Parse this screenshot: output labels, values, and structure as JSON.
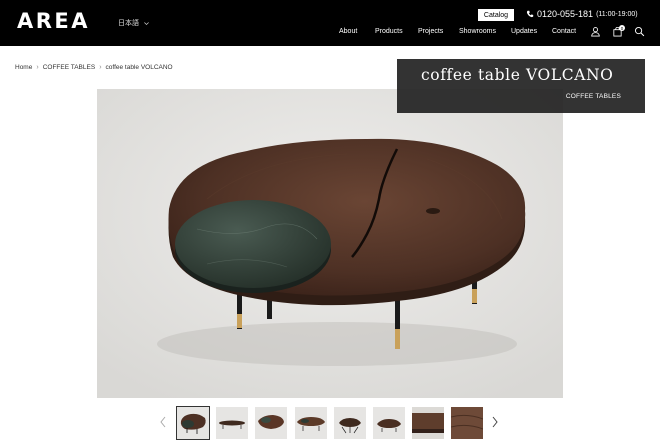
{
  "header": {
    "logo": "AREA",
    "language": "日本語",
    "catalog_label": "Catalog",
    "phone": "0120-055-181",
    "hours": "(11:00-19:00)",
    "nav": [
      "About",
      "Products",
      "Projects",
      "Showrooms",
      "Updates",
      "Contact"
    ],
    "cart_count": "0"
  },
  "breadcrumb": [
    "Home",
    "COFFEE TABLES",
    "coffee table VOLCANO"
  ],
  "product": {
    "title": "coffee table VOLCANO",
    "category": "COFFEE TABLES"
  },
  "gallery": {
    "thumbnail_count": 8,
    "active_index": 0
  }
}
